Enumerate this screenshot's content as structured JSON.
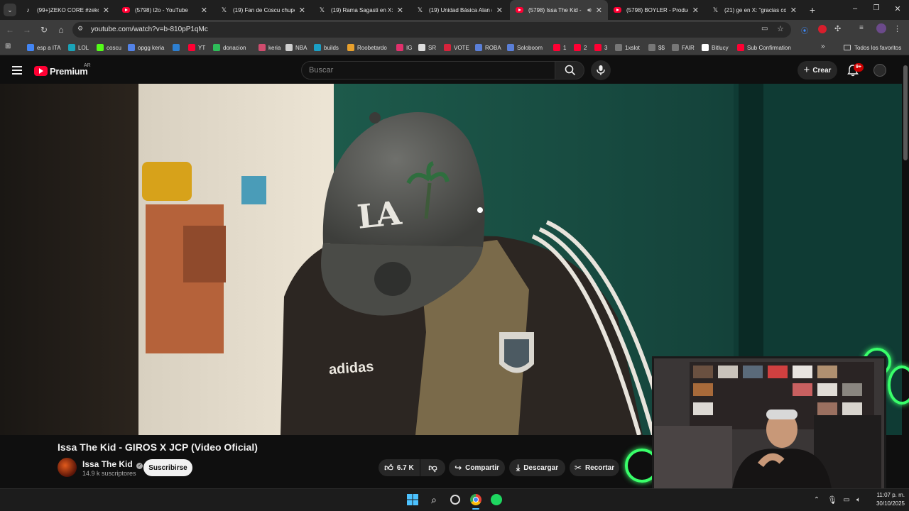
{
  "tabs": [
    {
      "title": "(99+)ZEKO CORE #zeko |",
      "icon": "tiktok-icon"
    },
    {
      "title": "(5798) t2o - YouTube",
      "icon": "youtube-icon"
    },
    {
      "title": "(19) Fan de Coscu chupet",
      "icon": "x-icon"
    },
    {
      "title": "(19) Rama Sagasti en X: \"",
      "icon": "x-icon"
    },
    {
      "title": "(19) Unidad Básica Alan (",
      "icon": "x-icon"
    },
    {
      "title": "(5798) Issa The Kid - ",
      "icon": "youtube-icon",
      "active": true,
      "audio": true
    },
    {
      "title": "(5798) BOYLER - Producti",
      "icon": "youtube-icon"
    },
    {
      "title": "(21) ge en X: \"gracias co:",
      "icon": "x-icon"
    }
  ],
  "toolbar": {
    "url": "youtube.com/watch?v=b-810pP1qMc"
  },
  "bookmarks": [
    {
      "label": "esp a ITA",
      "color": "#4285f4"
    },
    {
      "label": "LOL",
      "color": "#1aa3b8"
    },
    {
      "label": "coscu",
      "color": "#53fc18"
    },
    {
      "label": "opgg keria",
      "color": "#5383e8"
    },
    {
      "label": "",
      "color": "#2d7fd1"
    },
    {
      "label": "YT",
      "color": "#ff0033"
    },
    {
      "label": "donacion",
      "color": "#2ebd59"
    },
    {
      "label": "keria",
      "color": "#d04c6e"
    },
    {
      "label": "NBA",
      "color": "#cfcfcf"
    },
    {
      "label": "builds",
      "color": "#1a9fc5"
    },
    {
      "label": "Roobetardo",
      "color": "#e8a02c"
    },
    {
      "label": "IG",
      "color": "#e1306c"
    },
    {
      "label": "SR",
      "color": "#dddddd"
    },
    {
      "label": "VOTE",
      "color": "#d6233b"
    },
    {
      "label": "ROBA",
      "color": "#5a7fd8"
    },
    {
      "label": "Soloboom",
      "color": "#5a7fd8"
    },
    {
      "label": "1",
      "color": "#ff0033"
    },
    {
      "label": "2",
      "color": "#ff0033"
    },
    {
      "label": "3",
      "color": "#ff0033"
    },
    {
      "label": "1xslot",
      "color": "#777777"
    },
    {
      "label": "$$",
      "color": "#777777"
    },
    {
      "label": "FAIR",
      "color": "#777777"
    },
    {
      "label": "Bitlucy",
      "color": "#ffffff"
    },
    {
      "label": "Sub Confirmation",
      "color": "#ff0033"
    }
  ],
  "bookmarks_all": "Todos los favoritos",
  "yt": {
    "logo_text": "Premium",
    "region": "AR",
    "search_placeholder": "Buscar",
    "create_label": "Crear",
    "notif_count": "9+"
  },
  "video": {
    "title": "Issa The Kid - GIROS X JCP (Video Oficial)",
    "channel": "Issa The Kid",
    "subscribers": "14.9 k suscriptores",
    "subscribe_label": "Suscribirse",
    "likes": "6.7 K",
    "share_label": "Compartir",
    "download_label": "Descargar",
    "clip_label": "Recortar",
    "jacket_text": "adidas",
    "cap_text": "LA"
  },
  "taskbar": {
    "time": "11:07 p. m.",
    "date": "30/10/2025"
  },
  "colors": {
    "youtube_red": "#ff0033",
    "neon_green": "#39ff6a",
    "wall_green": "#1e5a4c"
  }
}
